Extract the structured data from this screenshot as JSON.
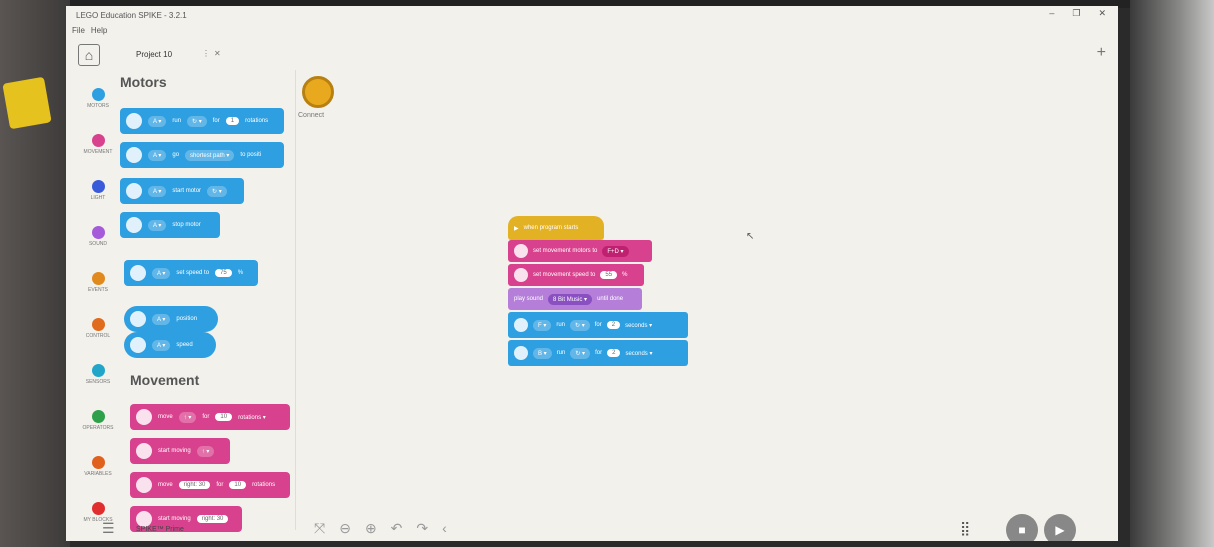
{
  "window": {
    "title": "LEGO Education SPIKE - 3.2.1",
    "controls": [
      "–",
      "❐",
      "✕"
    ]
  },
  "menu": [
    "File",
    "Help"
  ],
  "tab": {
    "name": "Project 10",
    "more": "⋮",
    "close": "✕"
  },
  "new_tab": "+",
  "categories": [
    {
      "label": "Motors",
      "color": "#2e9fe0"
    },
    {
      "label": "Movement",
      "color": "#d8418d"
    },
    {
      "label": "Light",
      "color": "#3a5bd9"
    },
    {
      "label": "Sound",
      "color": "#a45ad9"
    },
    {
      "label": "Events",
      "color": "#e08a1e"
    },
    {
      "label": "Control",
      "color": "#e06a1e"
    },
    {
      "label": "Sensors",
      "color": "#21a6c9"
    },
    {
      "label": "Operators",
      "color": "#2ea04a"
    },
    {
      "label": "Variables",
      "color": "#e0601e"
    },
    {
      "label": "My Blocks",
      "color": "#e02e2e"
    }
  ],
  "palette": {
    "motors_title": "Motors",
    "movement_title": "Movement",
    "motor_blocks": [
      {
        "port": "A ▾",
        "text": "run",
        "dir": "↻ ▾",
        "for": "for",
        "value": "1",
        "unit": "rotations"
      },
      {
        "port": "A ▾",
        "text": "go",
        "path": "shortest path ▾",
        "unit": "to positi"
      },
      {
        "port": "A ▾",
        "text": "start motor",
        "dir": "↻ ▾"
      },
      {
        "port": "A ▾",
        "text": "stop motor"
      },
      {
        "port": "A ▾",
        "text": "set speed to",
        "value": "75",
        "unit": "%"
      },
      {
        "port": "A ▾",
        "text": "position"
      },
      {
        "port": "A ▾",
        "text": "speed"
      }
    ],
    "movement_blocks": [
      {
        "text": "move",
        "dir": "↑ ▾",
        "for": "for",
        "value": "10",
        "unit": "rotations ▾"
      },
      {
        "text": "start moving",
        "dir": "↑ ▾"
      },
      {
        "text": "move",
        "steer": "right: 30",
        "for": "for",
        "value": "10",
        "unit": "rotations"
      },
      {
        "text": "start moving",
        "steer": "right: 30"
      }
    ]
  },
  "connect_label": "Connect",
  "script": {
    "hat": "when program starts",
    "b1": {
      "text": "set movement motors to",
      "value": "F+D ▾"
    },
    "b2": {
      "text": "set movement speed to",
      "value": "55",
      "unit": "%"
    },
    "b3": {
      "text": "play sound",
      "value": "8 Bit Music ▾",
      "suffix": "until done"
    },
    "b4": {
      "port": "F ▾",
      "text": "run",
      "dir": "↻ ▾",
      "for": "for",
      "value": "2",
      "unit": "seconds ▾"
    },
    "b5": {
      "port": "B ▾",
      "text": "run",
      "dir": "↻ ▾",
      "for": "for",
      "value": "2",
      "unit": "seconds ▾"
    }
  },
  "bottom": {
    "hub": "SPIKE™ Prime"
  }
}
